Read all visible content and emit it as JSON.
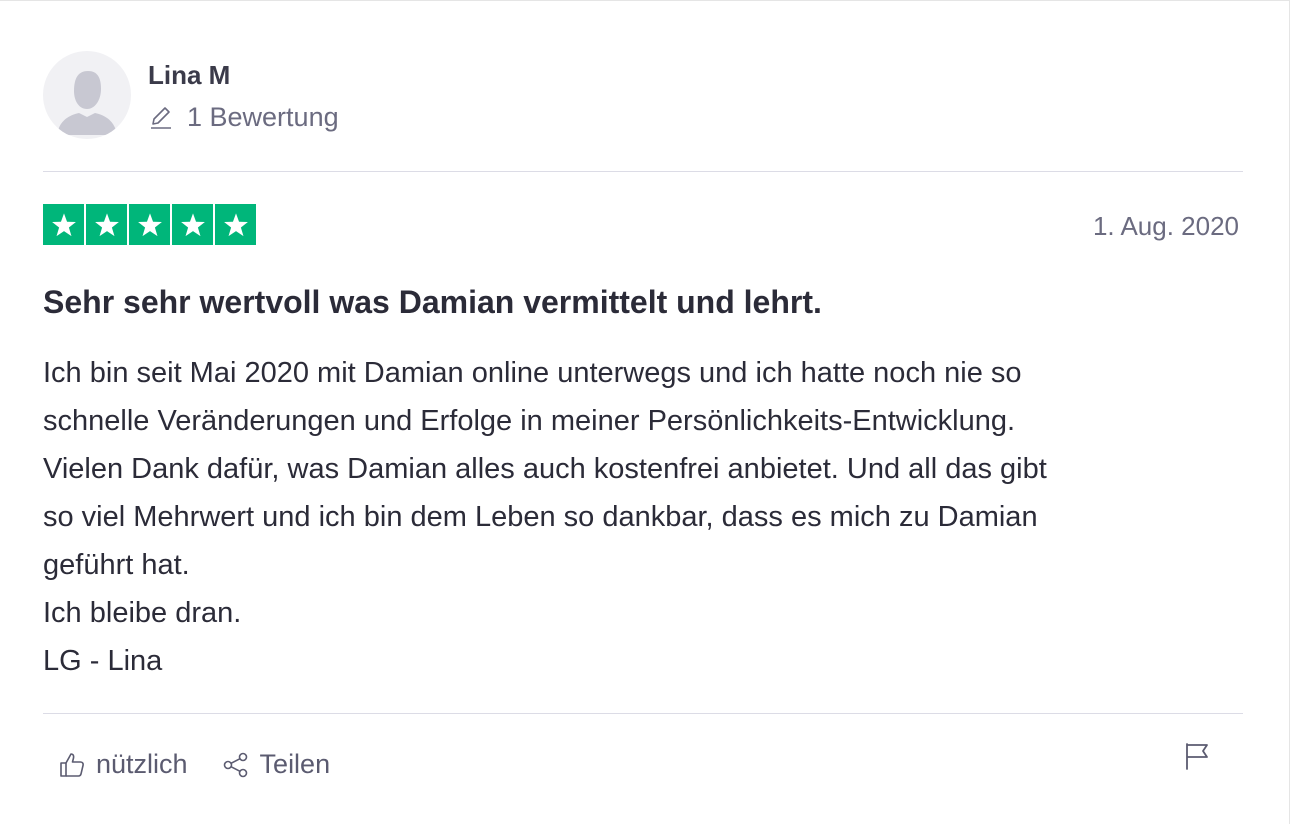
{
  "reviewer": {
    "name": "Lina M",
    "review_count": "1 Bewertung"
  },
  "review": {
    "rating": 5,
    "rating_max": 5,
    "date": "1. Aug. 2020",
    "title": "Sehr sehr wertvoll was Damian vermittelt und lehrt.",
    "body_lines": [
      "Ich bin seit Mai 2020 mit Damian online unterwegs und ich hatte noch nie so",
      "schnelle Veränderungen und Erfolge in meiner Persönlichkeits-Entwicklung.",
      "Vielen Dank dafür, was Damian alles auch kostenfrei anbietet. Und all das gibt",
      "so viel Mehrwert und ich bin dem Leben so dankbar, dass es mich zu Damian",
      "geführt hat.",
      "Ich bleibe dran.",
      "LG - Lina"
    ]
  },
  "actions": {
    "useful_label": "nützlich",
    "share_label": "Teilen"
  },
  "icons": {
    "avatar": "user-silhouette-icon",
    "review_count": "pencil-icon",
    "star": "star-icon",
    "useful": "thumbs-up-icon",
    "share": "share-icon",
    "report": "flag-icon"
  },
  "colors": {
    "star_fill": "#00b67a",
    "text_primary": "#2b2b38",
    "text_secondary": "#6b6b80"
  }
}
